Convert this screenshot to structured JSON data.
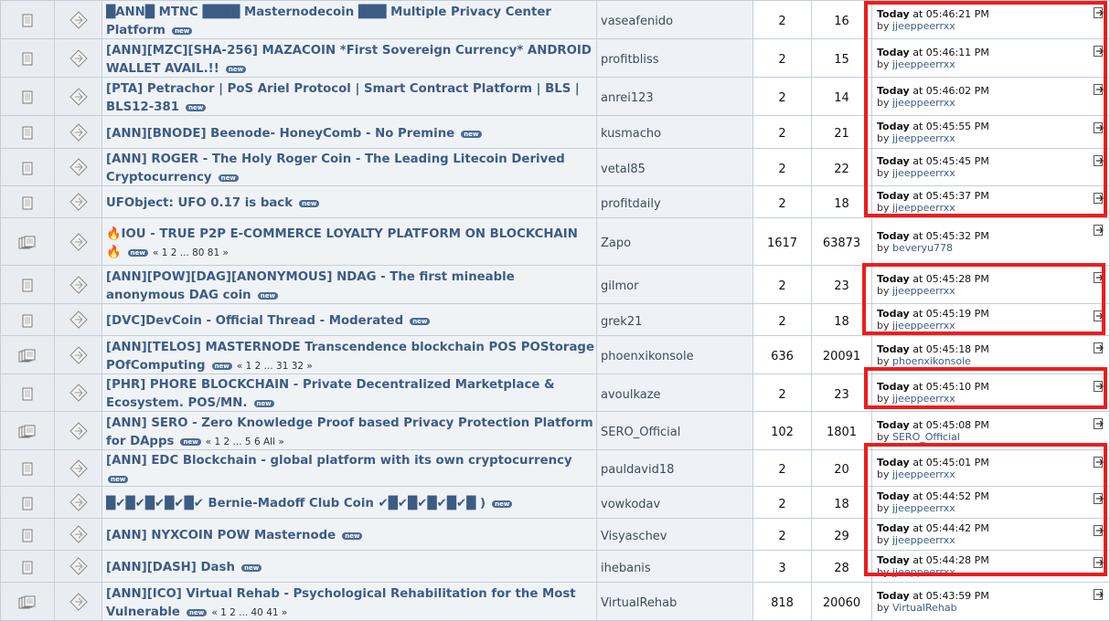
{
  "topics": [
    {
      "title": "█ANN█ MTNC ████ Masternodecoin ███ Multiple Privacy Center Platform",
      "pages": "",
      "starter": "vaseafenido",
      "replies": "2",
      "views": "16",
      "last_day": "Today",
      "last_time": " at 05:46:21 PM",
      "last_by": "jjeeppeerrxx",
      "h": 42,
      "hot": false
    },
    {
      "title": "[ANN][MZC][SHA-256] MAZACOIN *First Sovereign Currency* ANDROID WALLET AVAIL.!!",
      "pages": "",
      "starter": "profitbliss",
      "replies": "2",
      "views": "15",
      "last_day": "Today",
      "last_time": " at 05:46:11 PM",
      "last_by": "jjeeppeerrxx",
      "h": 42,
      "hot": false
    },
    {
      "title": "[PTA] Petrachor | PoS Ariel Protocol | Smart Contract Platform | BLS | BLS12-381",
      "pages": "",
      "starter": "anrei123",
      "replies": "2",
      "views": "14",
      "last_day": "Today",
      "last_time": " at 05:46:02 PM",
      "last_by": "jjeeppeerrxx",
      "h": 42,
      "hot": false
    },
    {
      "title": "[ANN][BNODE] Beenode- HoneyComb - No Premine",
      "pages": "",
      "starter": "kusmacho",
      "replies": "2",
      "views": "21",
      "last_day": "Today",
      "last_time": " at 05:45:55 PM",
      "last_by": "jjeeppeerrxx",
      "h": 36,
      "hot": false
    },
    {
      "title": "[ANN] ROGER - The Holy Roger Coin - The Leading Litecoin Derived Cryptocurrency",
      "pages": "",
      "starter": "vetal85",
      "replies": "2",
      "views": "22",
      "last_day": "Today",
      "last_time": " at 05:45:45 PM",
      "last_by": "jjeeppeerrxx",
      "h": 40,
      "hot": false
    },
    {
      "title": "UFObject: UFO 0.17 is back",
      "pages": "",
      "starter": "profitdaily",
      "replies": "2",
      "views": "18",
      "last_day": "Today",
      "last_time": " at 05:45:37 PM",
      "last_by": "jjeeppeerrxx",
      "h": 35,
      "hot": false
    },
    {
      "title": "🔥IOU - TRUE P2P E-COMMERCE LOYALTY PLATFORM ON BLOCKCHAIN 🔥",
      "pages": "« 1 2 ... 80 81 »",
      "starter": "Zapo",
      "replies": "1617",
      "views": "63873",
      "last_day": "Today",
      "last_time": " at 05:45:32 PM",
      "last_by": "beveryu778",
      "h": 52,
      "hot": true
    },
    {
      "title": "[ANN][POW][DAG][ANONYMOUS] NDAG - The first mineable anonymous DAG coin",
      "pages": "",
      "starter": "gilmor",
      "replies": "2",
      "views": "23",
      "last_day": "Today",
      "last_time": " at 05:45:28 PM",
      "last_by": "jjeeppeerrxx",
      "h": 42,
      "hot": false
    },
    {
      "title": "[DVC]DevCoin - Official Thread - Moderated",
      "pages": "",
      "starter": "grek21",
      "replies": "2",
      "views": "18",
      "last_day": "Today",
      "last_time": " at 05:45:19 PM",
      "last_by": "jjeeppeerrxx",
      "h": 35,
      "hot": false
    },
    {
      "title": "[ANN][TELOS] MASTERNODE Transcendence blockchain POS POStorage POfComputing",
      "pages": "« 1 2 ... 31 32 »",
      "starter": "phoenxikonsole",
      "replies": "636",
      "views": "20091",
      "last_day": "Today",
      "last_time": " at 05:45:18 PM",
      "last_by": "phoenxikonsole",
      "h": 42,
      "hot": true
    },
    {
      "title": "[PHR] PHORE BLOCKCHAIN - Private Decentralized Marketplace & Ecosystem. POS/MN.",
      "pages": "",
      "starter": "avoulkaze",
      "replies": "2",
      "views": "23",
      "last_day": "Today",
      "last_time": " at 05:45:10 PM",
      "last_by": "jjeeppeerrxx",
      "h": 40,
      "hot": false
    },
    {
      "title": "[ANN] SERO - Zero Knowledge Proof based Privacy Protection Platform for DApps",
      "pages": "« 1 2 ... 5 6 All »",
      "starter": "SERO_Official",
      "replies": "102",
      "views": "1801",
      "last_day": "Today",
      "last_time": " at 05:45:08 PM",
      "last_by": "SERO_Official",
      "h": 42,
      "hot": true
    },
    {
      "title": "[ANN] EDC Blockchain - global platform with its own cryptocurrency",
      "pages": "",
      "starter": "pauldavid18",
      "replies": "2",
      "views": "20",
      "last_day": "Today",
      "last_time": " at 05:45:01 PM",
      "last_by": "jjeeppeerrxx",
      "h": 36,
      "hot": false
    },
    {
      "title": "█✔█✔█✔█✔█✔ Bernie-Madoff Club Coin ✔█✔█✔█✔█✔█ )",
      "pages": "",
      "starter": "vowkodav",
      "replies": "2",
      "views": "18",
      "last_day": "Today",
      "last_time": " at 05:44:52 PM",
      "last_by": "jjeeppeerrxx",
      "h": 35,
      "hot": false
    },
    {
      "title": "[ANN] NYXCOIN POW Masternode",
      "pages": "",
      "starter": "Visyaschev",
      "replies": "2",
      "views": "29",
      "last_day": "Today",
      "last_time": " at 05:44:42 PM",
      "last_by": "jjeeppeerrxx",
      "h": 35,
      "hot": false
    },
    {
      "title": "[ANN][DASH] Dash",
      "pages": "",
      "starter": "ihebanis",
      "replies": "3",
      "views": "28",
      "last_day": "Today",
      "last_time": " at 05:44:28 PM",
      "last_by": "jjeeppeerrxx",
      "h": 35,
      "hot": false
    },
    {
      "title": "[ANN][ICO] Virtual Rehab - Psychological Rehabilitation for the Most Vulnerable",
      "pages": "« 1 2 ... 40 41 »",
      "starter": "VirtualRehab",
      "replies": "818",
      "views": "20060",
      "last_day": "Today",
      "last_time": " at 05:43:59 PM",
      "last_by": "VirtualRehab",
      "h": 42,
      "hot": true
    }
  ],
  "labels": {
    "new": "new",
    "by": "by "
  },
  "colors": {
    "highlight": "#ee1c1c",
    "link": "#3c5c85"
  }
}
